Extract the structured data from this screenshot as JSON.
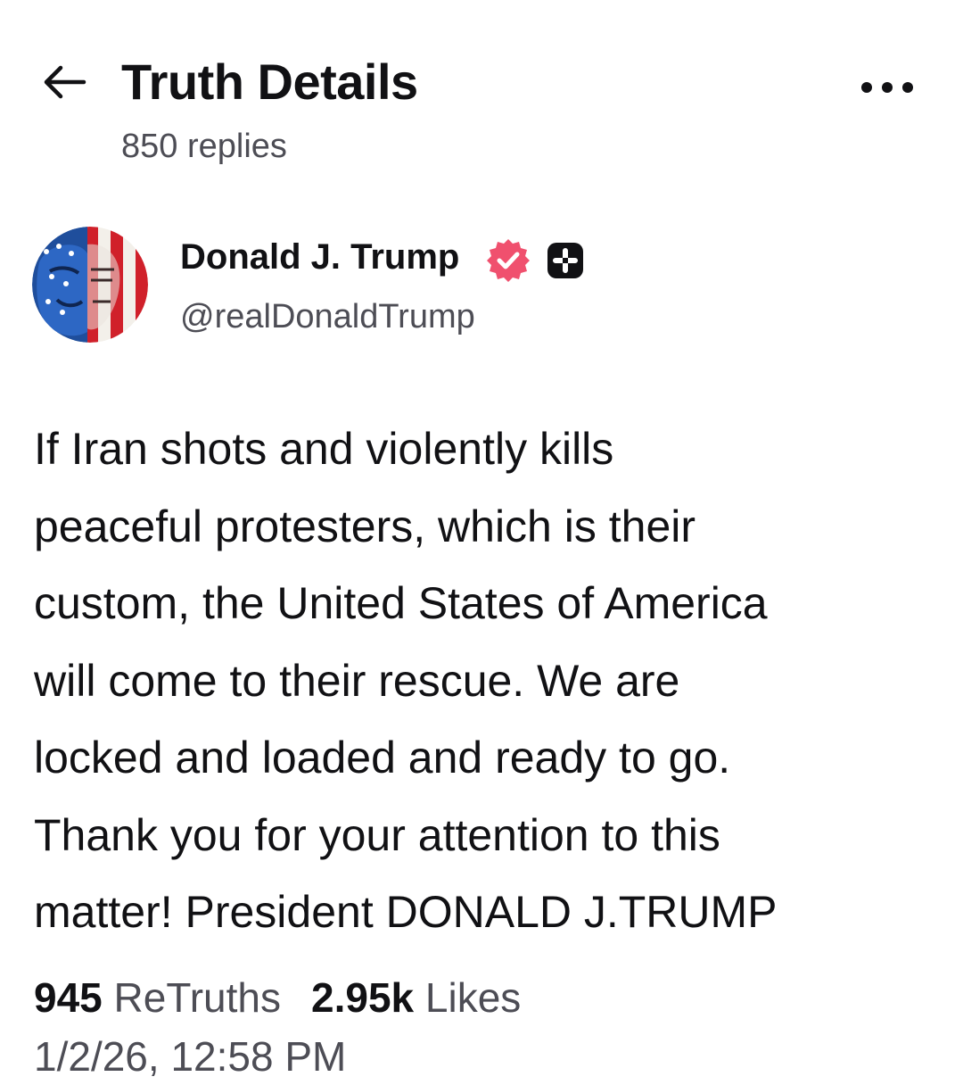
{
  "header": {
    "back_icon": "arrow-left-icon",
    "title": "Truth Details",
    "replies": "850 replies",
    "more_icon": "more-horizontal-icon"
  },
  "author": {
    "display_name": "Donald J. Trump",
    "handle": "@realDonaldTrump",
    "verified_icon": "verified-badge-icon",
    "verified_color": "#f0506e",
    "plus_icon": "truth-plus-badge-icon"
  },
  "post": {
    "lines": [
      "If Iran shots and violently kills",
      "peaceful protesters, which is their",
      "custom, the United States of America",
      "will come to their rescue. We are",
      "locked and loaded and ready to go.",
      "Thank you for your attention to this",
      "matter! President DONALD J.TRUMP"
    ]
  },
  "stats": {
    "retruths_count": "945",
    "retruths_label": "ReTruths",
    "likes_count": "2.95k",
    "likes_label": "Likes"
  },
  "timestamp": "1/2/26, 12:58 PM"
}
